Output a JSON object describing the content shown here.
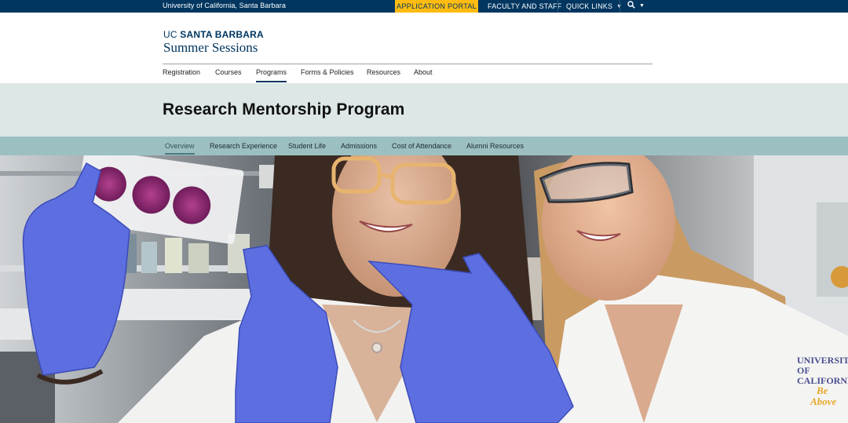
{
  "topbar": {
    "university": "University of California, Santa Barbara",
    "application_portal": "APPLICATION PORTAL",
    "faculty_staff": "FACULTY AND STAFF",
    "quick_links": "QUICK LINKS"
  },
  "brand": {
    "uc": "UC",
    "santa_barbara": "SANTA BARBARA",
    "summer_sessions": "Summer Sessions"
  },
  "main_nav": [
    {
      "label": "Registration"
    },
    {
      "label": "Courses"
    },
    {
      "label": "Programs",
      "active": true
    },
    {
      "label": "Forms & Policies"
    },
    {
      "label": "Resources"
    },
    {
      "label": "About"
    }
  ],
  "page": {
    "title": "Research Mentorship Program"
  },
  "sub_nav": [
    {
      "label": "Overview",
      "active": true
    },
    {
      "label": "Research Experience"
    },
    {
      "label": "Student Life"
    },
    {
      "label": "Admissions"
    },
    {
      "label": "Cost of Attendance"
    },
    {
      "label": "Alumni Resources"
    }
  ],
  "hero": {
    "coat_text_1": "UNIVERSITY",
    "coat_text_2": "OF",
    "coat_text_3": "CALIFORNIA",
    "coat_text_4": "Be",
    "coat_text_5": "Above"
  },
  "colors": {
    "navy": "#003660",
    "gold": "#FEBC11",
    "title_band": "#dce7e6",
    "sub_nav": "#9cc0c1",
    "glove": "#5d6fe0"
  },
  "icons": [
    "chevron-down-icon",
    "search-icon"
  ]
}
